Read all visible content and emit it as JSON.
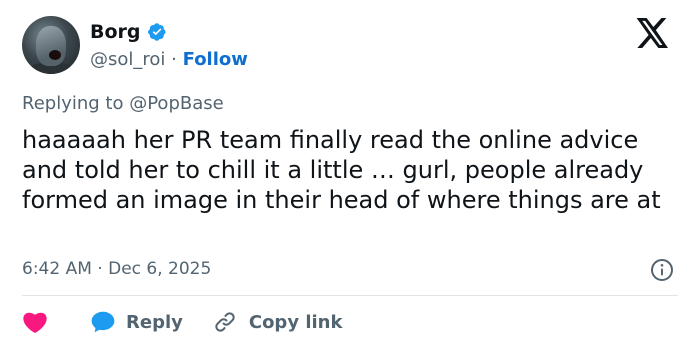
{
  "colors": {
    "verified": "#1d9bf0",
    "follow": "#0f6fcf",
    "heart": "#f91880",
    "reply_bubble": "#1d9bf0",
    "secondary_text": "#536471",
    "primary_text": "#0f1419"
  },
  "author": {
    "name": "Borg",
    "handle": "@sol_roi",
    "separator": "·",
    "follow_label": "Follow",
    "verified_icon": "verified-badge-icon",
    "avatar_icon": "avatar"
  },
  "brand": {
    "logo": "x-logo-icon"
  },
  "tweet": {
    "replying_prefix": "Replying to",
    "replying_to": "@PopBase",
    "text": "haaaaah her PR team finally read the online advice and told her to chill it a little … gurl, people already formed an image in their head of where things are at",
    "time": "6:42 AM",
    "date": "Dec 6, 2025",
    "meta_separator": "·"
  },
  "actions": {
    "like_icon": "heart-icon",
    "reply_icon": "reply-bubble-icon",
    "reply_label": "Reply",
    "copy_link_icon": "link-icon",
    "copy_link_label": "Copy link",
    "info_icon": "info-icon"
  }
}
